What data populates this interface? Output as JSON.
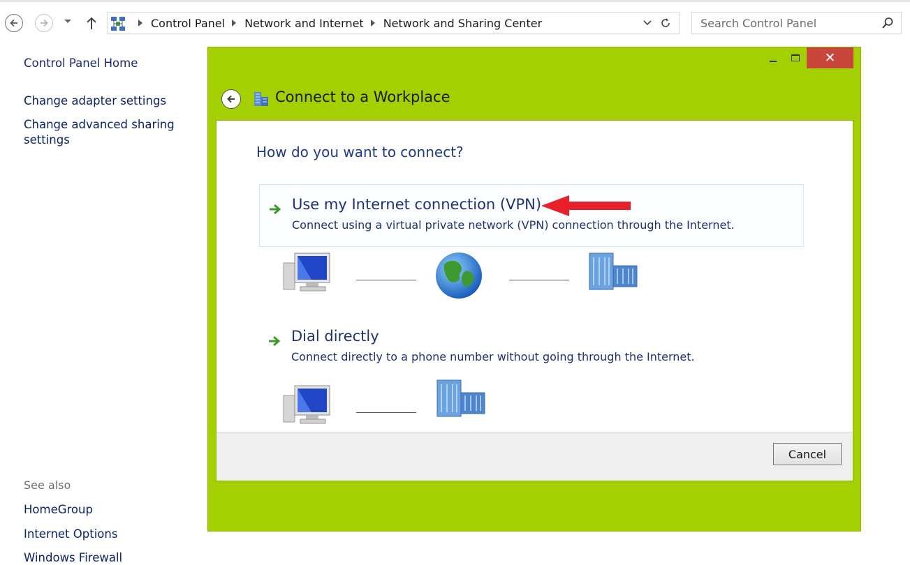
{
  "address_bar": {
    "breadcrumbs": [
      "Control Panel",
      "Network and Internet",
      "Network and Sharing Center"
    ],
    "search_placeholder": "Search Control Panel"
  },
  "left_nav": {
    "home": "Control Panel Home",
    "adapter": "Change adapter settings",
    "advanced": "Change advanced sharing settings",
    "see_also": "See also",
    "homegroup": "HomeGroup",
    "internet_options": "Internet Options",
    "firewall": "Windows Firewall"
  },
  "wizard": {
    "title": "Connect to a Workplace",
    "question": "How do you want to connect?",
    "options": [
      {
        "title": "Use my Internet connection (VPN)",
        "description": "Connect using a virtual private network (VPN) connection through the Internet."
      },
      {
        "title": "Dial directly",
        "description": "Connect directly to a phone number without going through the Internet."
      }
    ],
    "cancel_label": "Cancel"
  },
  "colors": {
    "wizard_frame": "#a4cf00",
    "close_button": "#c8453a",
    "link_text": "#0a246a",
    "heading_text": "#1e3a8a",
    "annotation_arrow": "#e8202a"
  }
}
